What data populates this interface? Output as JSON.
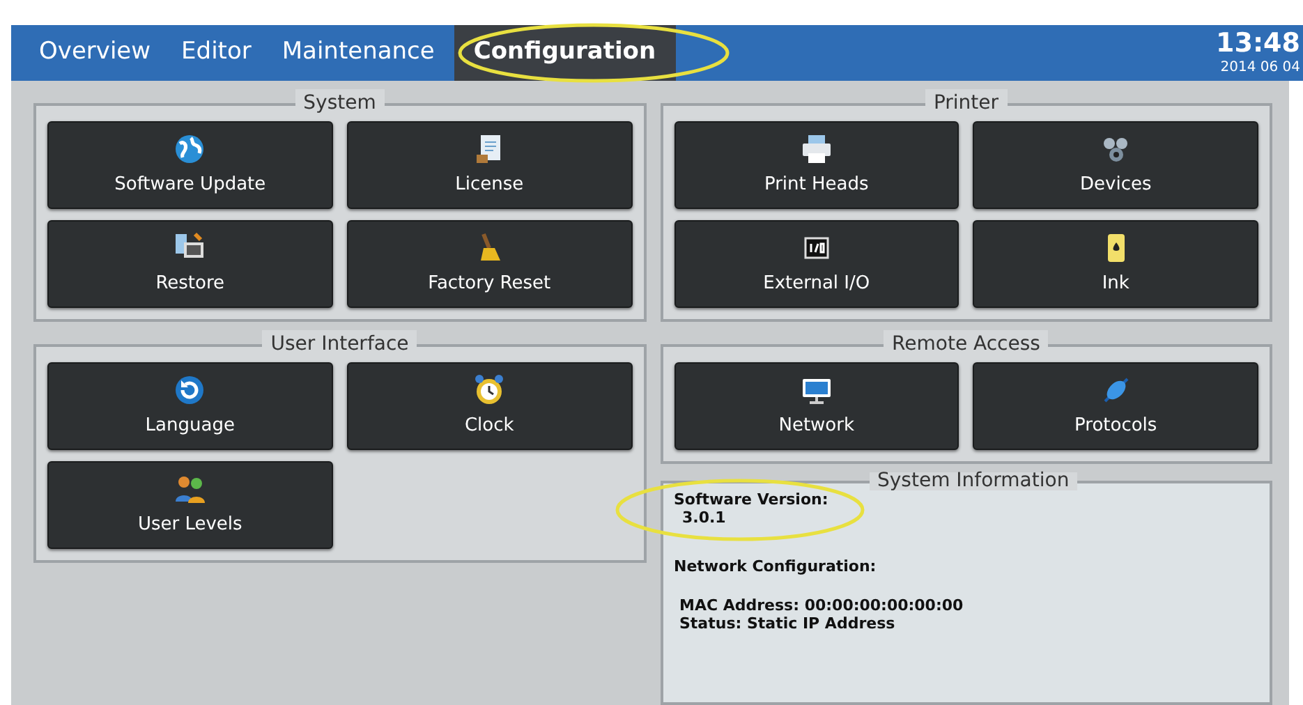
{
  "tabs": [
    {
      "label": "Overview",
      "selected": false
    },
    {
      "label": "Editor",
      "selected": false
    },
    {
      "label": "Maintenance",
      "selected": false
    },
    {
      "label": "Configuration",
      "selected": true
    }
  ],
  "clock": {
    "time": "13:48",
    "date": "2014 06 04"
  },
  "left_panels": [
    {
      "title": "System",
      "buttons": [
        "Software Update",
        "License",
        "Restore",
        "Factory Reset"
      ]
    },
    {
      "title": "User Interface",
      "buttons": [
        "Language",
        "Clock",
        "User Levels"
      ]
    }
  ],
  "right_panels": [
    {
      "title": "Printer",
      "buttons": [
        "Print Heads",
        "Devices",
        "External I/O",
        "Ink"
      ]
    },
    {
      "title": "Remote Access",
      "buttons": [
        "Network",
        "Protocols"
      ]
    }
  ],
  "system_information": {
    "title": "System Information",
    "software_version_label": "Software Version:",
    "software_version": "3.0.1",
    "network_heading": "Network Configuration:",
    "lines": [
      "MAC Address: 00:00:00:00:00:00",
      "Status: Static IP Address"
    ]
  }
}
